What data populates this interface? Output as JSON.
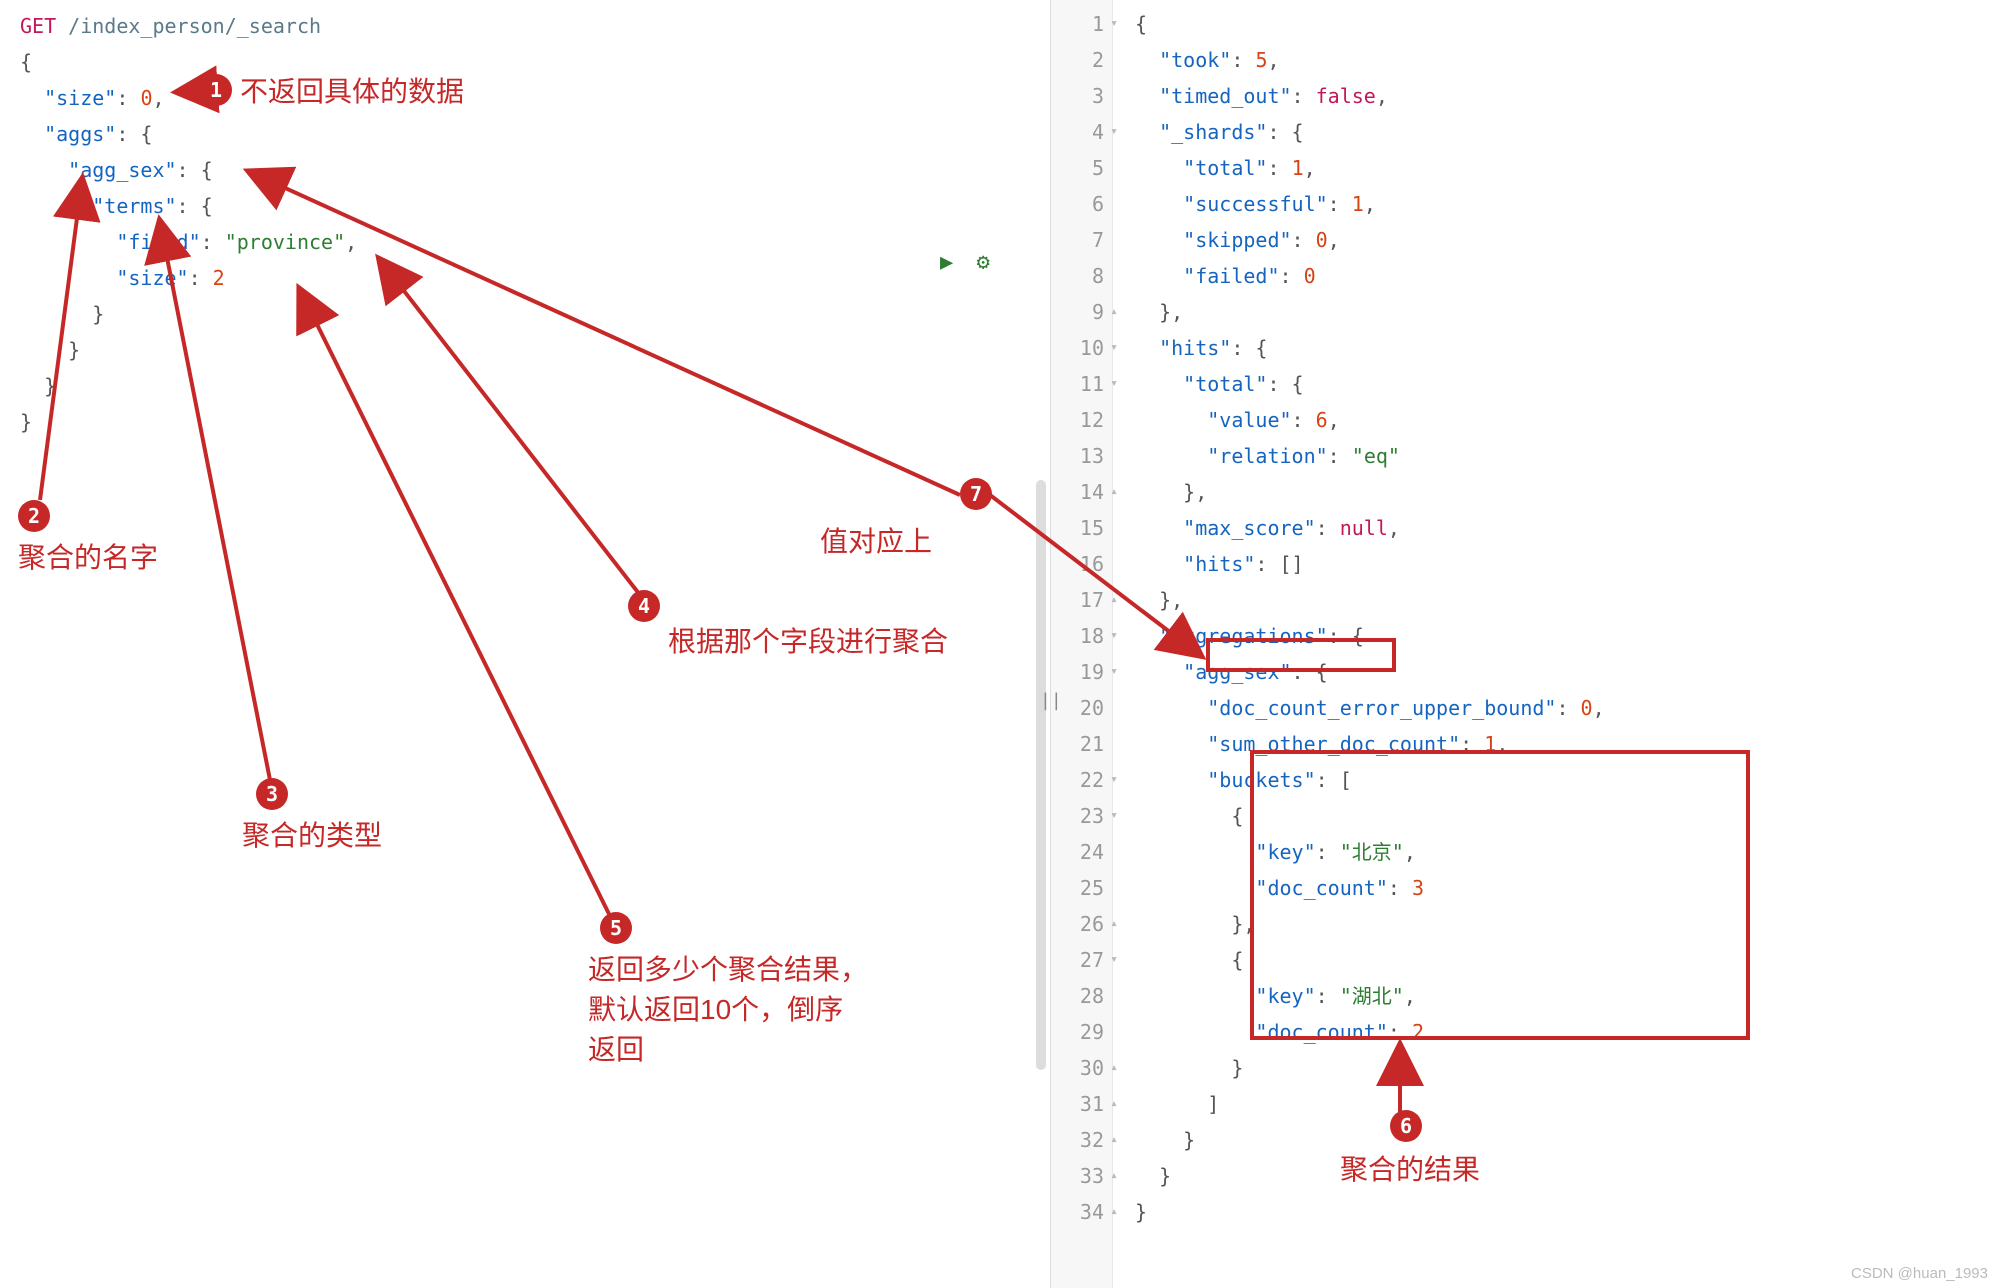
{
  "request": {
    "method": "GET",
    "path": "/index_person/_search",
    "body": {
      "size": 0,
      "aggs": {
        "agg_sex": {
          "terms": {
            "field": "province",
            "size": 2
          }
        }
      }
    }
  },
  "response": {
    "lines": 34,
    "took": 5,
    "timed_out": "false",
    "_shards": {
      "total": 1,
      "successful": 1,
      "skipped": 0,
      "failed": 0
    },
    "hits": {
      "total": {
        "value": 6,
        "relation": "eq"
      },
      "max_score": "null",
      "hits": "[]"
    },
    "aggregations": {
      "agg_sex": {
        "doc_count_error_upper_bound": 0,
        "sum_other_doc_count": 1,
        "buckets": [
          {
            "key": "北京",
            "doc_count": 3
          },
          {
            "key": "湖北",
            "doc_count": 2
          }
        ]
      }
    }
  },
  "annotations": {
    "1": "不返回具体的数据",
    "2": "聚合的名字",
    "3": "聚合的类型",
    "4": "根据那个字段进行聚合",
    "5": "返回多少个聚合结果，\n默认返回10个，倒序\n返回",
    "6": "聚合的结果",
    "7": "值对应上"
  },
  "icons": {
    "run": "▶",
    "wrench": "⚙"
  },
  "watermark": "CSDN @huan_1993"
}
